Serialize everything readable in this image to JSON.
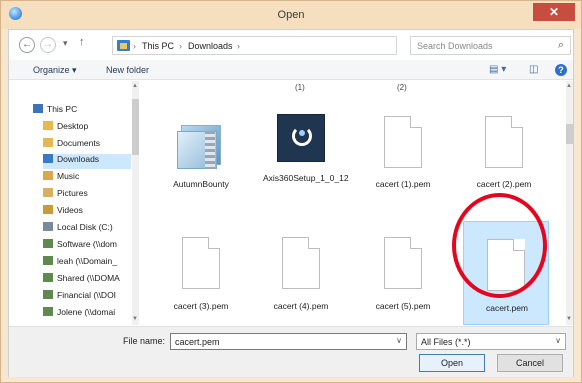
{
  "window": {
    "title": "Open",
    "close_glyph": "✕"
  },
  "nav": {
    "back_glyph": "←",
    "forward_glyph": "→",
    "recent_glyph": "▾",
    "up_glyph": "↑"
  },
  "address": {
    "crumbs": [
      "This PC",
      "Downloads"
    ],
    "separator_glyph": "›",
    "dropdown_glyph": "∨",
    "refresh_glyph": "↻"
  },
  "search": {
    "placeholder": "Search Downloads",
    "icon_glyph": "⌕"
  },
  "toolbar": {
    "organize_label": "Organize ▾",
    "new_folder_label": "New folder",
    "view_glyph": "▤ ▾",
    "pane_glyph": "◫",
    "help_glyph": "?"
  },
  "sidebar": {
    "items": [
      {
        "label": "This PC",
        "icon": "pc-icon"
      },
      {
        "label": "Desktop",
        "icon": "folder-icon"
      },
      {
        "label": "Documents",
        "icon": "folder-icon"
      },
      {
        "label": "Downloads",
        "icon": "downloads-icon"
      },
      {
        "label": "Music",
        "icon": "music-icon"
      },
      {
        "label": "Pictures",
        "icon": "pictures-icon"
      },
      {
        "label": "Videos",
        "icon": "videos-icon"
      },
      {
        "label": "Local Disk (C:)",
        "icon": "disk-icon"
      },
      {
        "label": "Software (\\\\dom",
        "icon": "network-drive-icon"
      },
      {
        "label": "leah (\\\\Domain_",
        "icon": "network-drive-icon"
      },
      {
        "label": "Shared (\\\\DOMA",
        "icon": "network-drive-icon"
      },
      {
        "label": "Financial (\\\\DOI",
        "icon": "network-drive-icon"
      },
      {
        "label": "Jolene (\\\\domai",
        "icon": "network-drive-icon"
      }
    ],
    "scroll_up_glyph": "▲",
    "scroll_down_glyph": "▼"
  },
  "files": {
    "top_labels": [
      "(1)",
      "(2)"
    ],
    "items": [
      {
        "name": "AutumnBounty",
        "icon": "zip-folder-icon"
      },
      {
        "name": "Axis360Setup_1_0_12",
        "icon": "installer-icon"
      },
      {
        "name": "cacert (1).pem",
        "icon": "document-icon"
      },
      {
        "name": "cacert (2).pem",
        "icon": "document-icon"
      },
      {
        "name": "cacert (3).pem",
        "icon": "document-icon"
      },
      {
        "name": "cacert (4).pem",
        "icon": "document-icon"
      },
      {
        "name": "cacert (5).pem",
        "icon": "document-icon"
      },
      {
        "name": "cacert.pem",
        "icon": "document-icon",
        "selected": true
      }
    ],
    "scroll_up_glyph": "▲",
    "scroll_down_glyph": "▼"
  },
  "bottom": {
    "file_name_label": "File name:",
    "file_name_value": "cacert.pem",
    "file_name_dropdown_glyph": "∨",
    "file_type_value": "All Files (*.*)",
    "file_type_dropdown_glyph": "∨",
    "open_label": "Open",
    "cancel_label": "Cancel"
  },
  "colors": {
    "highlight_circle": "#e3061e",
    "selection": "#cce8ff",
    "title_bar": "#f6dfbf"
  }
}
